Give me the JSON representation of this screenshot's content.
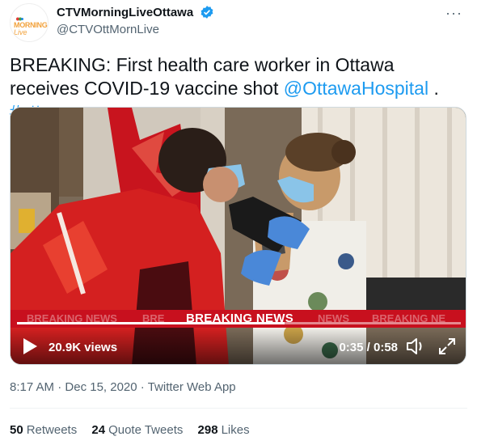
{
  "author": {
    "display_name": "CTVMorningLiveOttawa",
    "handle": "@CTVOttMornLive",
    "avatar_text_1": "MORNING",
    "avatar_text_2": "Live",
    "verified_icon": "verified-badge-icon",
    "more_icon": "more-options-icon"
  },
  "tweet": {
    "text_prefix": "BREAKING: First health care worker in Ottawa receives COVID-19 vaccine shot ",
    "mention": "@OttawaHospital",
    "separator": " . ",
    "hashtag": "#ottnews"
  },
  "video": {
    "ticker_main": "BREAKING NEWS",
    "ticker_ghost_left": "BREAKING NEWS",
    "ticker_ghost_left2": "BRE",
    "ticker_ghost_right": "NEWS",
    "ticker_ghost_right2": "BREAKING NE",
    "views": "20.9K views",
    "time": "0:35 / 0:58",
    "progress_fraction": 0.603,
    "play_icon": "play-icon",
    "volume_icon": "volume-icon",
    "fullscreen_icon": "fullscreen-icon"
  },
  "meta": {
    "time": "8:17 AM",
    "sep1": " · ",
    "date": "Dec 15, 2020",
    "sep2": " · ",
    "source": "Twitter Web App"
  },
  "stats": {
    "retweets_count": "50",
    "retweets_label": "Retweets",
    "quotes_count": "24",
    "quotes_label": "Quote Tweets",
    "likes_count": "298",
    "likes_label": "Likes"
  },
  "colors": {
    "link": "#1d9bf0",
    "ticker": "#c8101e",
    "verified": "#1d9bf0"
  }
}
